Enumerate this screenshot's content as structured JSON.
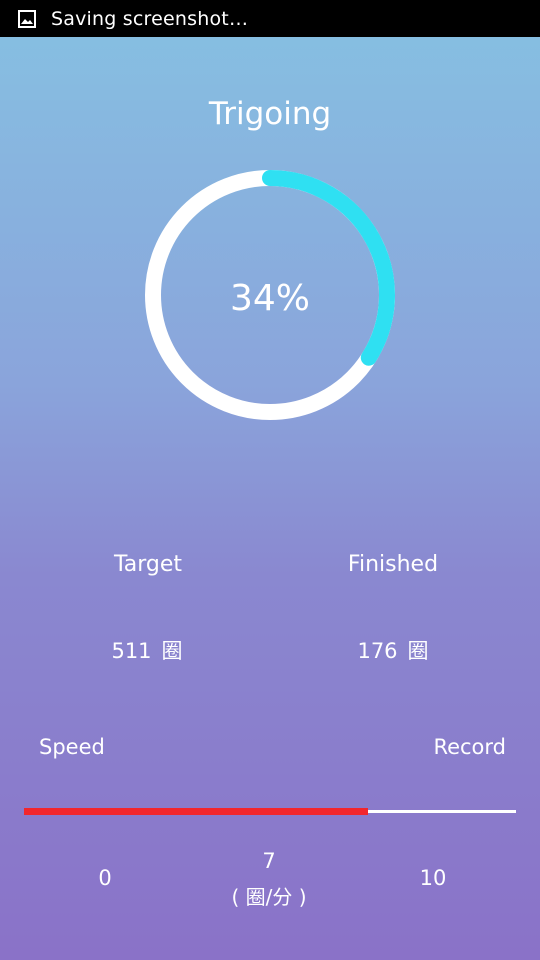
{
  "status_bar": {
    "icon": "image-icon",
    "text": "Saving screenshot…",
    "background": "#000000"
  },
  "app": {
    "title": "Trigoing"
  },
  "progress": {
    "fraction": 0.34,
    "label": "34%",
    "ring_color": "#ffffff",
    "arc_color": "#2fe0f2"
  },
  "stats": {
    "target": {
      "label": "Target",
      "value": "511",
      "unit": "圈"
    },
    "finished": {
      "label": "Finished",
      "value": "176",
      "unit": "圈"
    }
  },
  "speed": {
    "label": "Speed",
    "record_label": "Record",
    "min": "0",
    "max": "10",
    "current": "7",
    "unit": "( 圈/分 )",
    "fill_fraction": 0.7,
    "fill_color": "#f2262d",
    "track_color": "#ffffff"
  }
}
